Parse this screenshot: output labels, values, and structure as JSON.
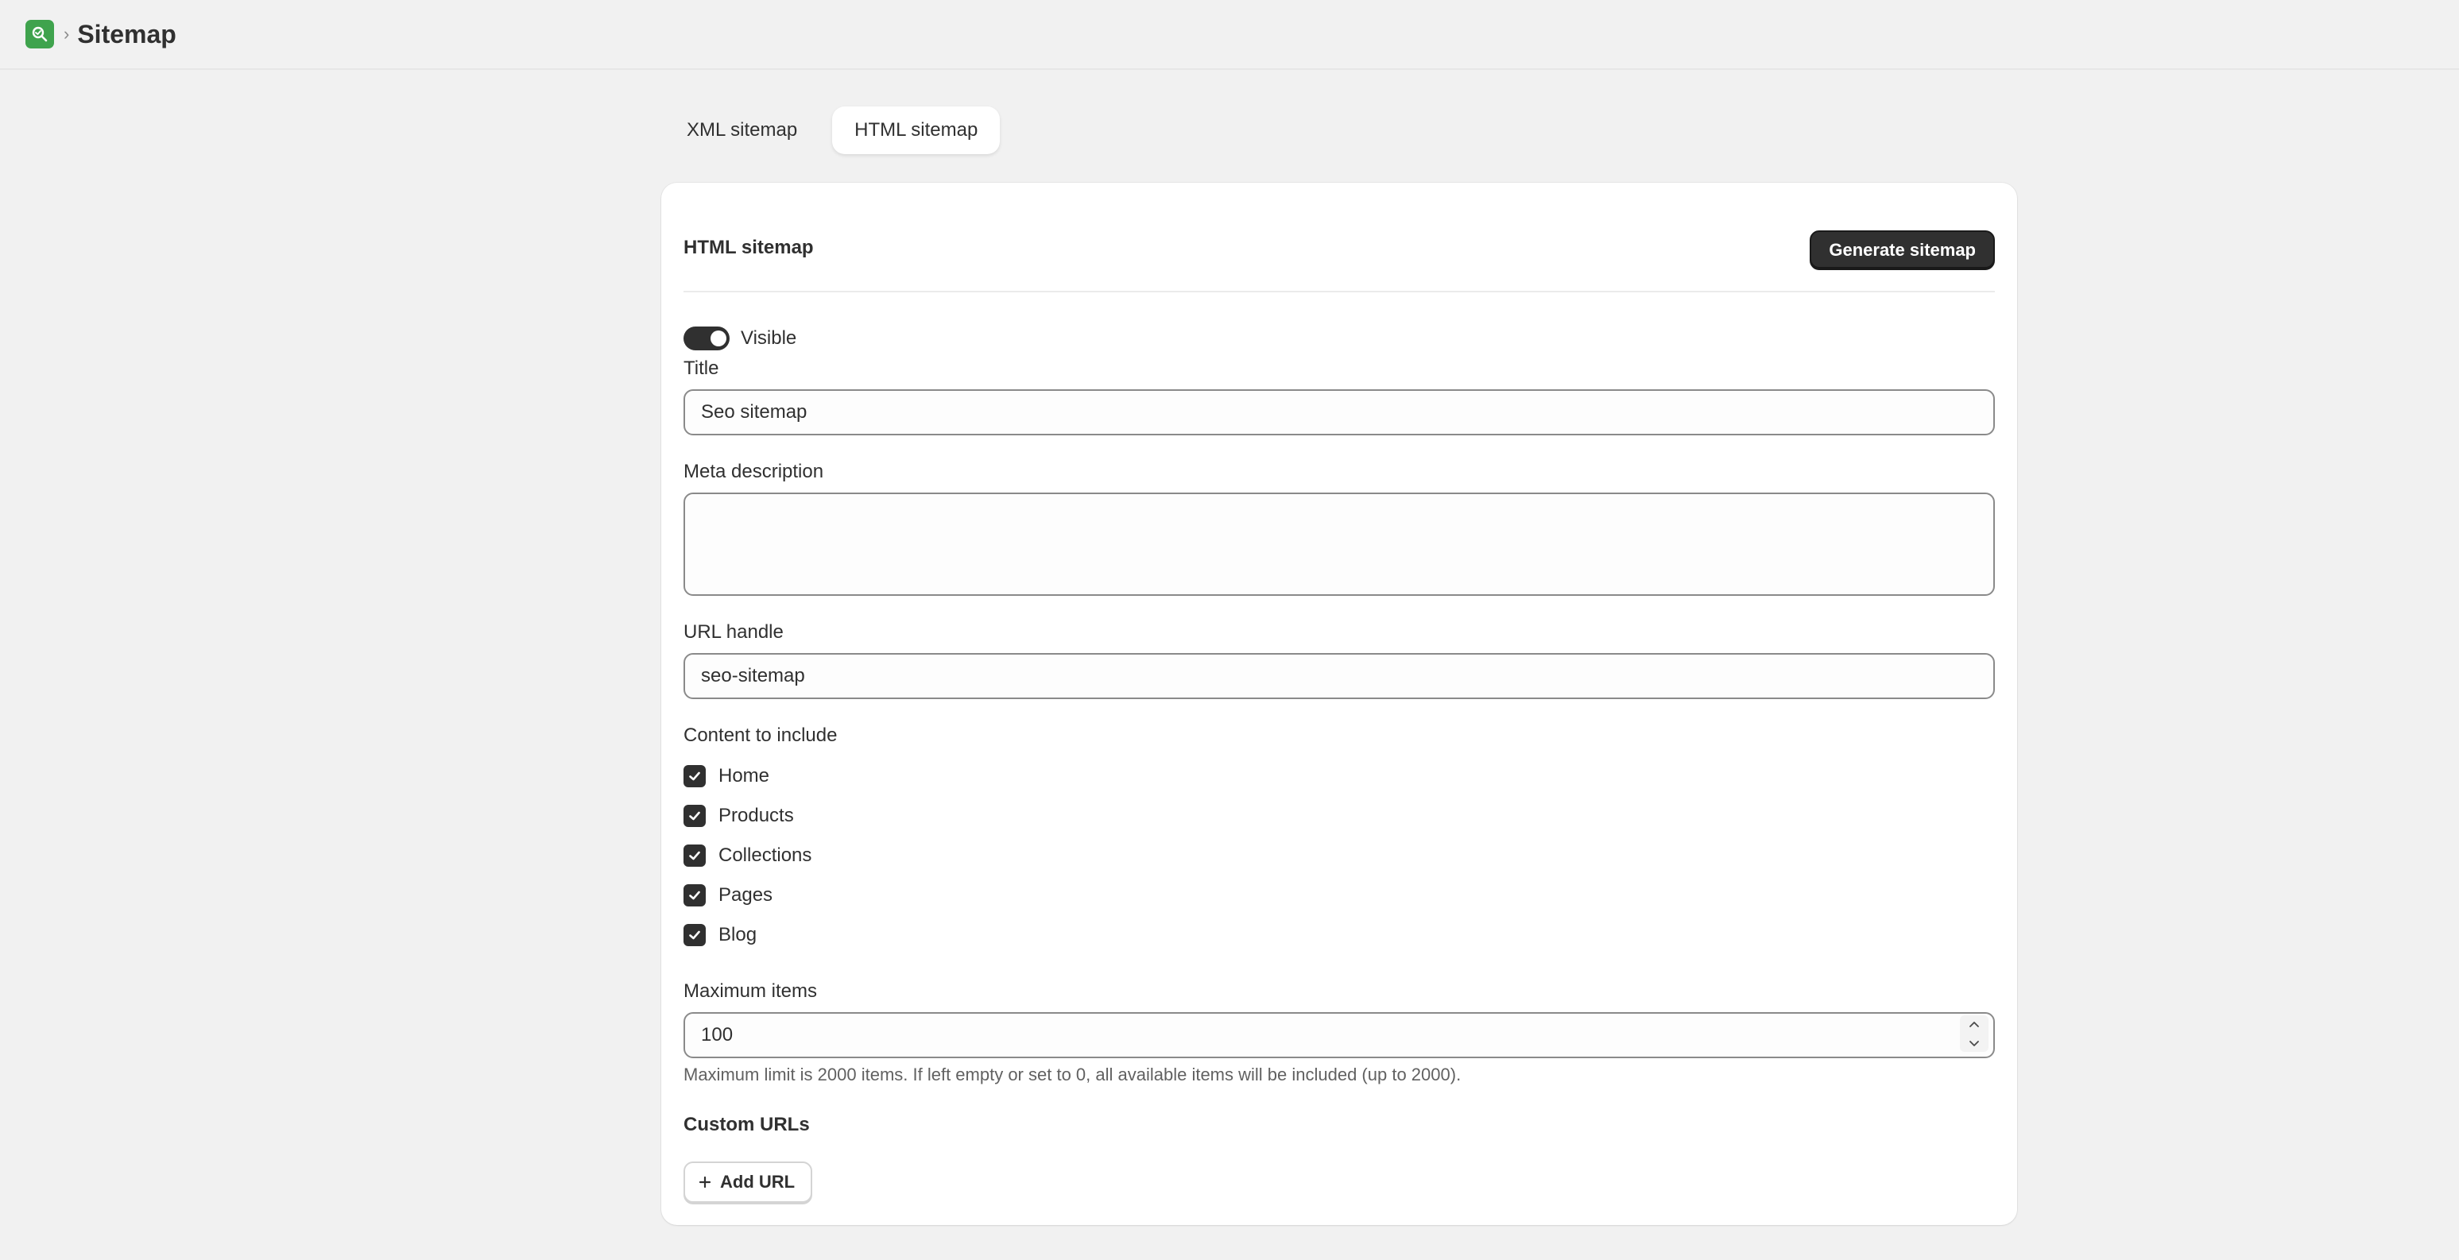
{
  "header": {
    "breadcrumb_separator": "›",
    "page_title": "Sitemap"
  },
  "tabs": [
    {
      "label": "XML sitemap",
      "active": false
    },
    {
      "label": "HTML sitemap",
      "active": true
    }
  ],
  "card": {
    "title": "HTML sitemap",
    "generate_button": "Generate sitemap",
    "visibility": {
      "label": "Visible",
      "on": true
    },
    "title_field": {
      "label": "Title",
      "value": "Seo sitemap"
    },
    "meta_description": {
      "label": "Meta description",
      "value": ""
    },
    "url_handle": {
      "label": "URL handle",
      "value": "seo-sitemap"
    },
    "content": {
      "label": "Content to include",
      "items": [
        {
          "label": "Home",
          "checked": true
        },
        {
          "label": "Products",
          "checked": true
        },
        {
          "label": "Collections",
          "checked": true
        },
        {
          "label": "Pages",
          "checked": true
        },
        {
          "label": "Blog",
          "checked": true
        }
      ]
    },
    "max_items": {
      "label": "Maximum items",
      "value": "100",
      "help": "Maximum limit is 2000 items. If left empty or set to 0, all available items will be included (up to 2000)."
    },
    "custom_urls": {
      "title": "Custom URLs",
      "add_button": "Add URL"
    }
  },
  "colors": {
    "background": "#f1f1f1",
    "primary_button": "#303030",
    "app_logo": "#3fa34d"
  },
  "icons": [
    "app-logo-icon",
    "checkmark-icon",
    "chevron-up-icon",
    "chevron-down-icon",
    "plus-icon"
  ]
}
